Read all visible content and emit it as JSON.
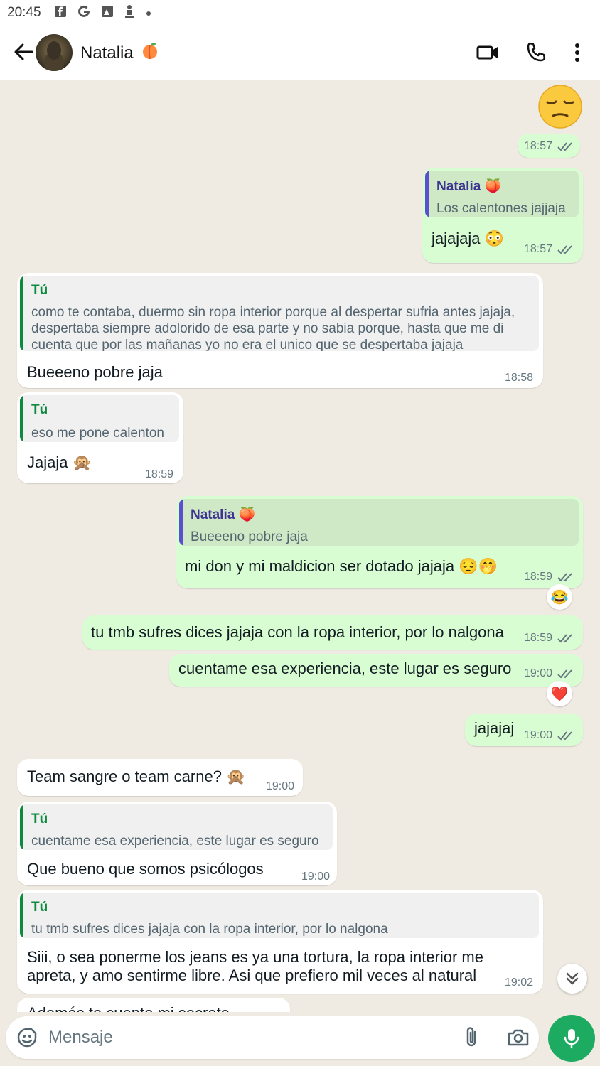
{
  "status_bar": {
    "time": "20:45",
    "icons": [
      "facebook-icon",
      "google-icon",
      "image-icon",
      "chess-icon",
      "dot-icon"
    ]
  },
  "header": {
    "contact_name": "Natalia",
    "contact_emoji": "peach"
  },
  "colors": {
    "outgoing": "#d9fdd3",
    "incoming": "#ffffff",
    "accent_green": "#1daa61",
    "quote_bar_natalia": "#5b4fd0",
    "quote_bar_tu": "#0e8a3e",
    "ticks": "#667781"
  },
  "messages": [
    {
      "id": "m1",
      "dir": "out",
      "sticker": "pensive-emoji",
      "time": "18:57"
    },
    {
      "id": "m2",
      "dir": "out",
      "quote_author": "Natalia 🍑",
      "quote_text": "Los calentones jajjaja",
      "text": "jajajaja 😳",
      "time": "18:57"
    },
    {
      "id": "m3",
      "dir": "in",
      "quote_author": "Tú",
      "quote_text": "como te contaba, duermo sin ropa interior porque al despertar sufria antes jajaja, despertaba siempre adolorido de esa parte y no sabia porque, hasta que me di cuenta que por las mañanas yo no era el unico que se despertaba jajaja",
      "text": "Bueeeno pobre jaja",
      "time": "18:58"
    },
    {
      "id": "m4",
      "dir": "in",
      "quote_author": "Tú",
      "quote_text": "eso me pone calenton",
      "text": "Jajaja 🙊",
      "time": "18:59"
    },
    {
      "id": "m5",
      "dir": "out",
      "quote_author": "Natalia 🍑",
      "quote_text": "Bueeeno pobre jaja",
      "text": "mi don y mi maldicion ser dotado jajaja 😔🤭",
      "time": "18:59",
      "reaction": "😂"
    },
    {
      "id": "m6",
      "dir": "out",
      "text": "tu tmb sufres dices jajaja con la ropa interior, por lo nalgona",
      "time": "18:59"
    },
    {
      "id": "m7",
      "dir": "out",
      "text": "cuentame esa experiencia, este lugar es seguro",
      "time": "19:00",
      "reaction": "❤️"
    },
    {
      "id": "m8",
      "dir": "out",
      "text": "jajajaj",
      "time": "19:00"
    },
    {
      "id": "m9",
      "dir": "in",
      "text": "Team sangre o team carne? 🙊",
      "time": "19:00"
    },
    {
      "id": "m10",
      "dir": "in",
      "quote_author": "Tú",
      "quote_text": "cuentame esa experiencia, este lugar es seguro",
      "text": "Que bueno que somos psicólogos",
      "time": "19:00"
    },
    {
      "id": "m11",
      "dir": "in",
      "quote_author": "Tú",
      "quote_text": "tu tmb sufres dices jajaja con la ropa interior, por lo nalgona",
      "text_line1": "Siii, o sea ponerme los jeans es ya una tortura, la ropa interior me",
      "text_line2": "apreta, y amo sentirme libre. Asi que prefiero mil veces al natural",
      "time": "19:02"
    },
    {
      "id": "m12",
      "dir": "in",
      "text": "Además te cuento mi secreto"
    }
  ],
  "input": {
    "placeholder": "Mensaje"
  }
}
